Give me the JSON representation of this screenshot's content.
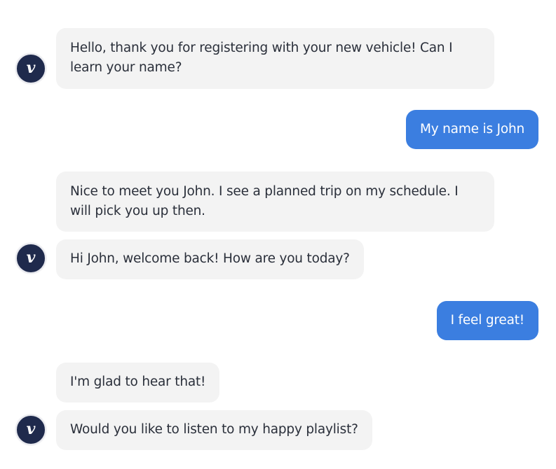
{
  "assistant": {
    "avatar_letter": "v",
    "avatar_color": "#1f2a4c"
  },
  "colors": {
    "bot_bubble": "#f3f3f3",
    "user_bubble": "#3b7ee0"
  },
  "messages": [
    {
      "sender": "bot",
      "text": "Hello, thank you for registering with your new vehicle! Can I learn your name?"
    },
    {
      "sender": "user",
      "text": "My name is John"
    },
    {
      "sender": "bot",
      "text": "Nice to meet you John. I see a planned trip on my schedule. I will pick you up then."
    },
    {
      "sender": "bot",
      "text": "Hi John, welcome back! How are you today?"
    },
    {
      "sender": "user",
      "text": "I feel great!"
    },
    {
      "sender": "bot",
      "text": "I'm glad to hear that!"
    },
    {
      "sender": "bot",
      "text": "Would you like to listen to my happy playlist?"
    }
  ]
}
